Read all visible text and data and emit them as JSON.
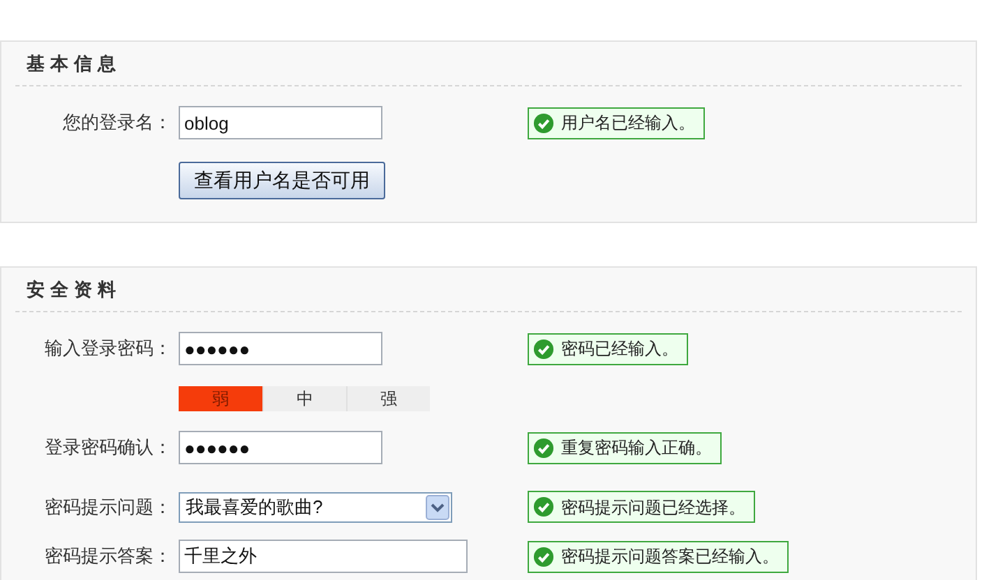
{
  "sections": [
    {
      "title": "基本信息",
      "rows": [
        {
          "kind": "input",
          "label": "您的登录名：",
          "value": "oblog",
          "message": "用户名已经输入。"
        },
        {
          "kind": "button",
          "text": "查看用户名是否可用"
        }
      ]
    },
    {
      "title": "安全资料",
      "rows": [
        {
          "kind": "input",
          "label": "输入登录密码：",
          "value": "●●●●●●",
          "message": "密码已经输入。"
        },
        {
          "kind": "strength",
          "segments": [
            {
              "label": "弱",
              "selected": true
            },
            {
              "label": "中",
              "selected": false
            },
            {
              "label": "强",
              "selected": false
            }
          ]
        },
        {
          "kind": "input",
          "label": "登录密码确认：",
          "value": "●●●●●●",
          "message": "重复密码输入正确。"
        },
        {
          "kind": "select",
          "label": "密码提示问题：",
          "value": "我最喜爱的歌曲?",
          "message": "密码提示问题已经选择。"
        },
        {
          "kind": "wideinput",
          "label": "密码提示答案：",
          "value": "千里之外",
          "message": "密码提示问题答案已经输入。"
        }
      ]
    }
  ]
}
